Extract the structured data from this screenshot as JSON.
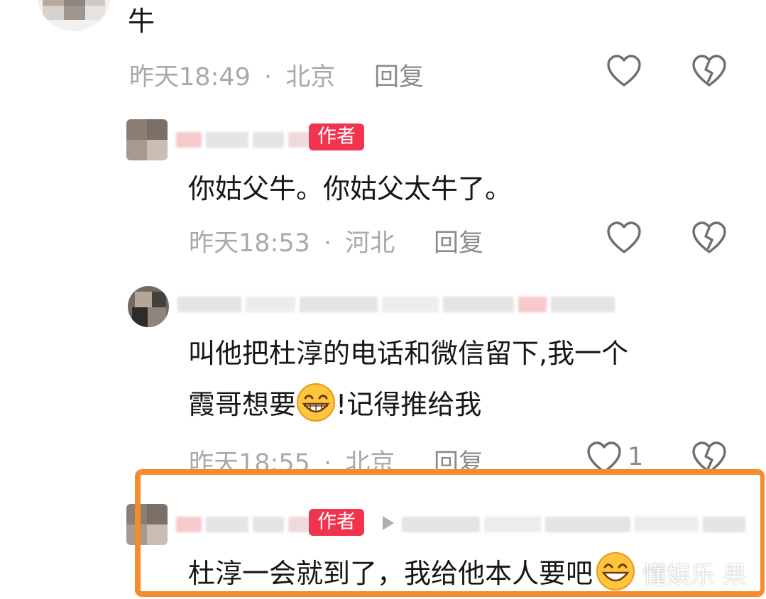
{
  "comments": [
    {
      "text_lines": [
        "牛"
      ],
      "time": "昨天18:49",
      "dot": "·",
      "location": "北京",
      "reply_label": "回复",
      "like_count": ""
    },
    {
      "badge": "作者",
      "text_lines": [
        "你姑父牛。你姑父太牛了。"
      ],
      "time": "昨天18:53",
      "dot": "·",
      "location": "河北",
      "reply_label": "回复",
      "like_count": ""
    },
    {
      "text_line1": "叫他把杜淳的电话和微信留下,我一个",
      "text_line2a": "霞哥想要",
      "text_line2b": "!记得推给我",
      "time": "昨天18:55",
      "dot": "·",
      "location": "北京",
      "reply_label": "回复",
      "like_count": "1"
    },
    {
      "badge": "作者",
      "text_lines": [
        "杜淳一会就到了，我给他本人要吧"
      ]
    }
  ],
  "watermark": "懂娱乐 果",
  "colors": {
    "badge_bg": "#f1344e",
    "highlight_border": "#f48c2c",
    "meta_text": "#a9a9a9",
    "body_text": "#161616"
  },
  "icons": [
    "like-heart-icon",
    "dislike-broken-heart-icon",
    "grin-emoji-icon",
    "reply-arrow-icon"
  ]
}
